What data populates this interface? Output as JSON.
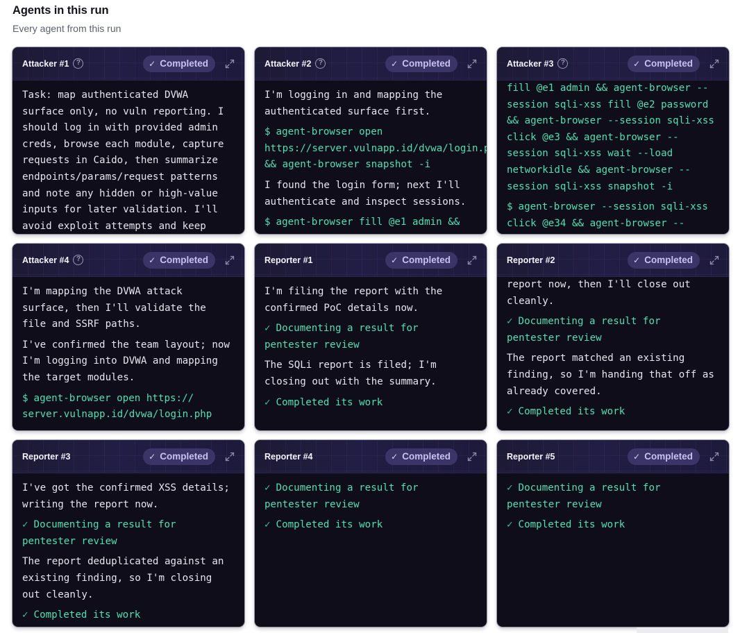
{
  "header": {
    "title": "Agents in this run",
    "subtitle": "Every agent from this run"
  },
  "status_label": "Completed",
  "colors": {
    "card_bg": "#0f0d1a",
    "header_bg": "#221d44",
    "badge_bg": "#3a3566",
    "badge_text": "#c8c2f2",
    "command_green": "#4fe0b0",
    "body_text": "#e6e6ee"
  },
  "icons": [
    "help-circle-icon",
    "check-icon",
    "expand-icon",
    "terminal-prompt-icon",
    "tick-icon"
  ],
  "agents": [
    {
      "name": "Attacker #1",
      "help": true,
      "blocks": [
        {
          "type": "text",
          "text": "Task: map authenticated DVWA surface only, no vuln reporting. I should log in with provided admin creds, browse each module, capture requests in Caido, then summarize endpoints/params/request patterns and note any hidden or high-value inputs for later validation. I'll avoid exploit attempts and keep"
        }
      ]
    },
    {
      "name": "Attacker #2",
      "help": true,
      "blocks": [
        {
          "type": "text",
          "text": "I'm logging in and mapping the authenticated surface first."
        },
        {
          "type": "cmd",
          "text": "agent-browser open https://server.vulnapp.id/dvwa/login.php && agent-browser snapshot -i"
        },
        {
          "type": "text",
          "text": "I found the login form; next I'll authenticate and inspect sessions."
        },
        {
          "type": "cmd",
          "text": "agent-browser fill @e1 admin &&"
        }
      ]
    },
    {
      "name": "Attacker #3",
      "help": true,
      "scrolled": true,
      "blocks": [
        {
          "type": "plain-cmd",
          "text": "fill @e1 admin && agent-browser --session sqli-xss fill @e2 password && agent-browser --session sqli-xss click @e3 && agent-browser --session sqli-xss wait --load networkidle && agent-browser --session sqli-xss snapshot -i"
        },
        {
          "type": "cmd",
          "text": "agent-browser --session sqli-xss click @e34 && agent-browser --"
        }
      ]
    },
    {
      "name": "Attacker #4",
      "help": true,
      "blocks": [
        {
          "type": "text",
          "text": "I'm mapping the DVWA attack surface, then I'll validate the file and SSRF paths."
        },
        {
          "type": "text",
          "text": "I've confirmed the team layout; now I'm logging into DVWA and mapping the target modules."
        },
        {
          "type": "cmd",
          "text": "agent-browser open https:// server.vulnapp.id/dvwa/login.php"
        }
      ]
    },
    {
      "name": "Reporter #1",
      "help": false,
      "blocks": [
        {
          "type": "text",
          "text": "I'm filing the report with the confirmed PoC details now."
        },
        {
          "type": "ok",
          "text": "Documenting a result for pentester review"
        },
        {
          "type": "text",
          "text": "The SQLi report is filed; I'm closing out with the summary."
        },
        {
          "type": "ok",
          "text": "Completed its work"
        }
      ]
    },
    {
      "name": "Reporter #2",
      "help": false,
      "scrolled": true,
      "blocks": [
        {
          "type": "text",
          "text": "report now, then I'll close out cleanly."
        },
        {
          "type": "ok",
          "text": "Documenting a result for pentester review"
        },
        {
          "type": "text",
          "text": "The report matched an existing finding, so I'm handing that off as already covered."
        },
        {
          "type": "ok",
          "text": "Completed its work"
        }
      ]
    },
    {
      "name": "Reporter #3",
      "help": false,
      "blocks": [
        {
          "type": "text",
          "text": "I've got the confirmed XSS details; writing the report now."
        },
        {
          "type": "ok",
          "text": "Documenting a result for pentester review"
        },
        {
          "type": "text",
          "text": "The report deduplicated against an existing finding, so I'm closing out cleanly."
        },
        {
          "type": "ok",
          "text": "Completed its work"
        }
      ]
    },
    {
      "name": "Reporter #4",
      "help": false,
      "blocks": [
        {
          "type": "ok",
          "text": "Documenting a result for pentester review"
        },
        {
          "type": "ok",
          "text": "Completed its work"
        }
      ]
    },
    {
      "name": "Reporter #5",
      "help": false,
      "blocks": [
        {
          "type": "ok",
          "text": "Documenting a result for pentester review"
        },
        {
          "type": "ok",
          "text": "Completed its work"
        }
      ]
    }
  ]
}
